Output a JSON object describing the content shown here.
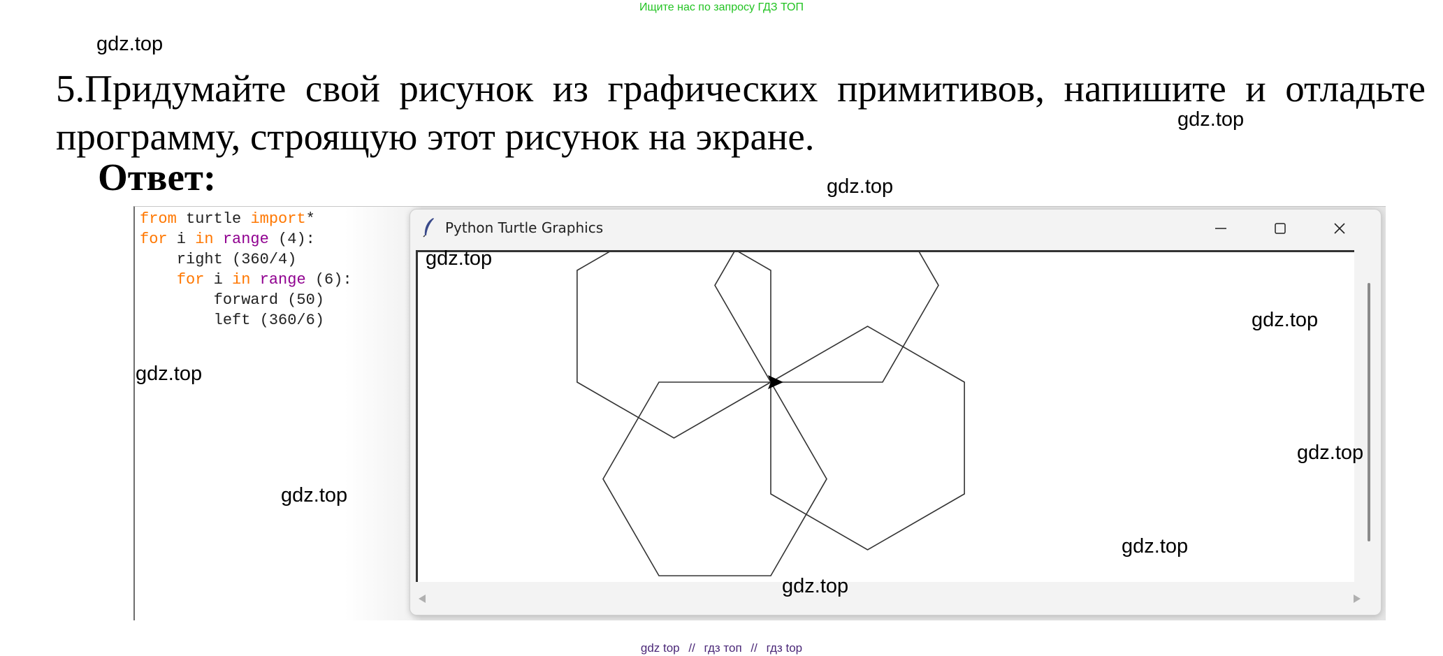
{
  "banner": "Ищите нас по запросу ГДЗ ТОП",
  "watermark": "gdz.top",
  "task_text": "5.Придумайте свой рисунок из графических примитивов, напишите и отладьте программу, строящую этот рисунок на экране.",
  "answer_label": "Ответ:",
  "code": {
    "lines": [
      [
        "from",
        " turtle ",
        "import",
        "*"
      ],
      [
        "for",
        " i ",
        "in",
        " ",
        "range",
        " (4):"
      ],
      [
        "    right (360/4)"
      ],
      [
        "    ",
        "for",
        " i ",
        "in",
        " ",
        "range",
        " (6):"
      ],
      [
        "        forward (50)"
      ],
      [
        "        left (360/6)"
      ]
    ],
    "line1_kw1": "from",
    "line1_mid": " turtle ",
    "line1_kw2": "import",
    "line1_end": "*",
    "line2_kw1": "for",
    "line2_mid": " i ",
    "line2_kw2": "in",
    "line2_bi": "range",
    "line2_end": " (4):",
    "line3": "    right (360/4)",
    "line4_indent": "    ",
    "line4_kw1": "for",
    "line4_mid": " i ",
    "line4_kw2": "in",
    "line4_bi": "range",
    "line4_end": " (6):",
    "line5": "        forward (50)",
    "line6": "        left (360/6)"
  },
  "window": {
    "title": "Python Turtle Graphics",
    "icon": "feather-icon",
    "controls": [
      "minimize-icon",
      "maximize-icon",
      "close-icon"
    ]
  },
  "turtle_drawing": {
    "shape": "hexagon",
    "count": 4,
    "side_length": 50,
    "turn_between_shapes_deg": 90
  },
  "footer": {
    "part1": "gdz top",
    "sep": "//",
    "part2": "гдз топ",
    "part3": "гдз top"
  },
  "colors": {
    "banner": "#22c322",
    "keyword": "#ff7700",
    "builtin": "#900090",
    "footer": "#4b2878"
  }
}
